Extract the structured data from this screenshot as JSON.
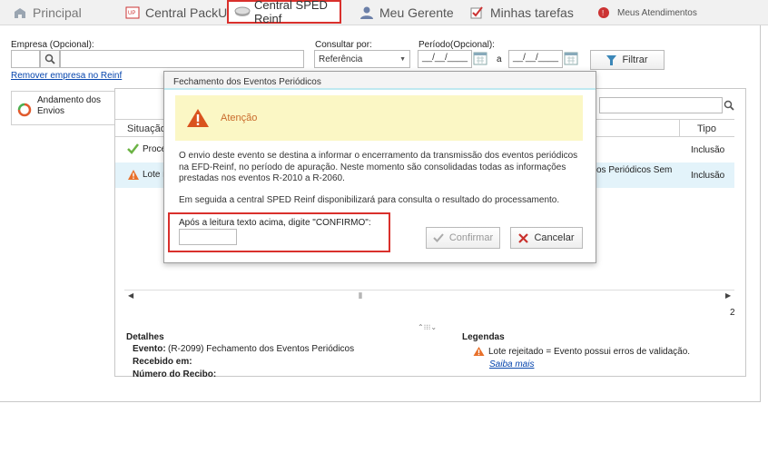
{
  "tabs": [
    {
      "label": "Principal",
      "icon": "home-icon"
    },
    {
      "label": "Central PackUp",
      "icon": "up-icon"
    },
    {
      "label": "Central SPED Reinf",
      "icon": "disk-icon"
    },
    {
      "label": "Meu Gerente",
      "icon": "person-icon"
    },
    {
      "label": "Minhas tarefas",
      "icon": "checkbox-icon"
    },
    {
      "label": "Meus Atendimentos",
      "icon": "bell-icon"
    }
  ],
  "filters": {
    "empresa_label": "Empresa (Opcional):",
    "remover_link": "Remover empresa no Reinf",
    "consultar_label": "Consultar por:",
    "consultar_value": "Referência",
    "periodo_label": "Período(Opcional):",
    "date_from": "__/__/____",
    "date_sep": "a",
    "date_to": "__/__/____",
    "filtrar_button": "Filtrar"
  },
  "sidebar": {
    "item_label": "Andamento dos Envios"
  },
  "grid": {
    "col_situacao": "Situação",
    "col_tipo": "Tipo",
    "rows": [
      {
        "situacao": "Proce",
        "desc": "",
        "tipo": "Inclusão"
      },
      {
        "situacao": "Lote r",
        "desc": "os Periódicos Sem",
        "tipo": "Inclusão"
      }
    ],
    "page_count": "2"
  },
  "details": {
    "title": "Detalhes",
    "evento_label": "Evento:",
    "evento_value": "(R-2099) Fechamento dos Eventos Periódicos",
    "recebido_label": "Recebido em:",
    "recibo_label": "Número do Recibo:"
  },
  "legend": {
    "title": "Legendas",
    "text": "Lote rejeitado = Evento possui erros de validação.",
    "link": "Saiba mais"
  },
  "modal": {
    "title": "Fechamento dos Eventos Periódicos",
    "alert_title": "Atenção",
    "paragraph1": "O envio deste evento se destina a informar o encerramento da transmissão dos eventos periódicos na EFD-Reinf, no período de apuração. Neste momento são consolidadas todas as informações prestadas nos eventos R-2010 a R-2060.",
    "paragraph2": "Em seguida a central SPED Reinf disponibilizará para consulta o resultado do processamento.",
    "confirm_prompt": "Após a leitura  texto acima, digite \"CONFIRMO\":",
    "confirm_input": "",
    "confirmar_button": "Confirmar",
    "cancelar_button": "Cancelar"
  }
}
